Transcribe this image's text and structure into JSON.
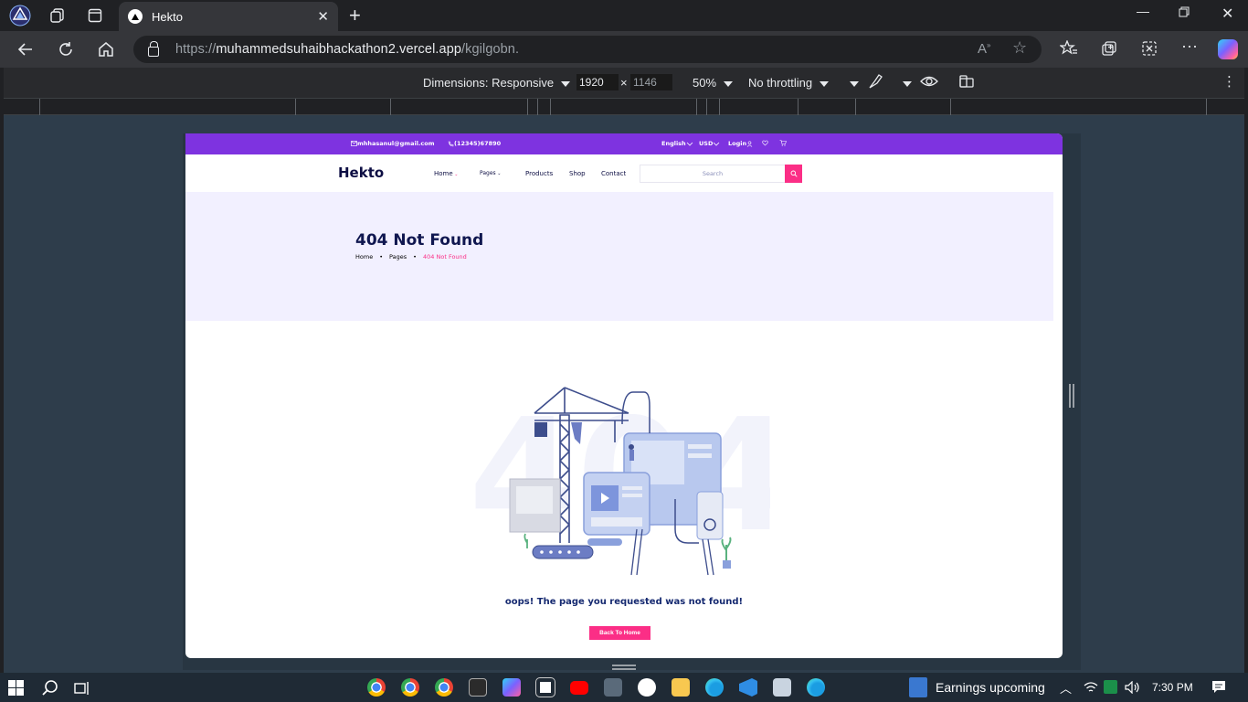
{
  "browser": {
    "tab_title": "Hekto",
    "tab_close": "✕",
    "new_tab": "+",
    "url_prefix": "https://",
    "url_host": "muhammedsuhaibhackathon2.vercel.app",
    "url_path": "/kgilgobn."
  },
  "devtools": {
    "dimensions_label": "Dimensions: Responsive",
    "width": "1920",
    "times": "×",
    "height": "1146",
    "zoom": "50%",
    "throttling": "No throttling"
  },
  "site": {
    "email": "mhhasanul@gmail.com",
    "phone": "(12345)67890",
    "language": "English",
    "currency": "USD",
    "login": "Login",
    "logo": "Hekto",
    "nav": [
      "Home",
      "Pages",
      "Products",
      "Shop",
      "Contact"
    ],
    "search_placeholder": "Search",
    "page_title": "404 Not Found",
    "breadcrumb": [
      "Home",
      "Pages",
      "404 Not Found"
    ],
    "breadcrumb_sep": "•",
    "message": "oops! The page you requested was not found!",
    "back_button": "Back To Home",
    "colors": {
      "topbar": "#7e33e0",
      "accent": "#fb2e86",
      "navy": "#101750",
      "hero_bg": "#f2f0ff"
    }
  },
  "taskbar": {
    "notification": "Earnings upcoming",
    "time": "7:30 PM"
  }
}
